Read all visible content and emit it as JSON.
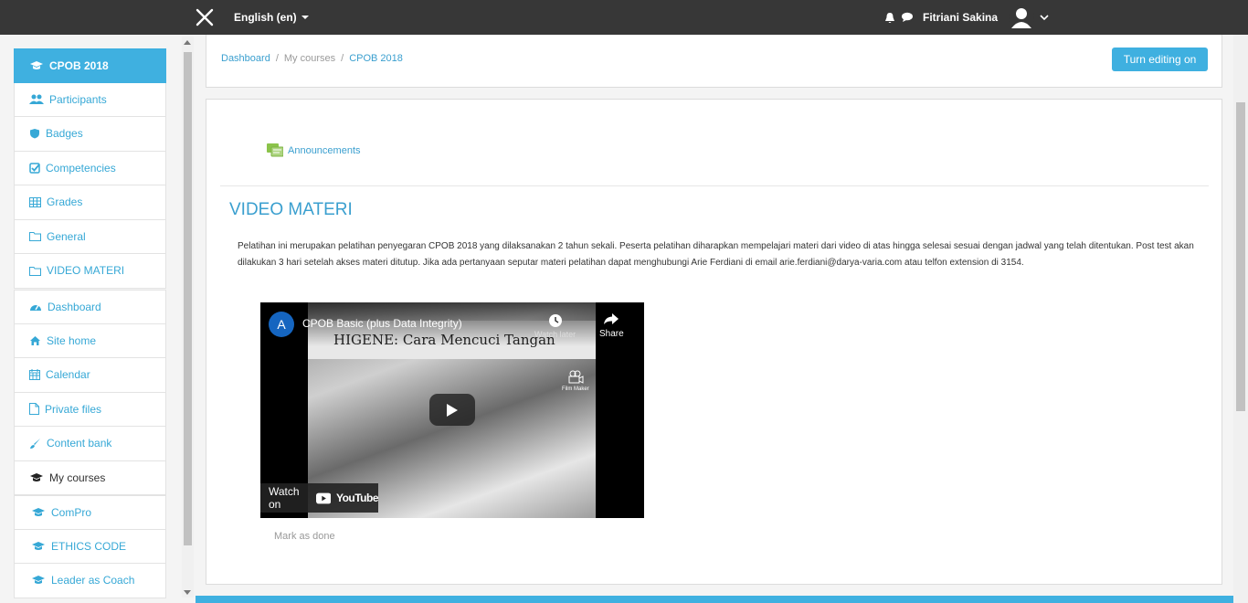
{
  "topbar": {
    "language": "English (en)",
    "user_name": "Fitriani Sakina"
  },
  "sidebar": {
    "items": [
      {
        "label": "CPOB 2018",
        "icon": "graduation-cap-icon",
        "active": true
      },
      {
        "label": "Participants",
        "icon": "users-icon"
      },
      {
        "label": "Badges",
        "icon": "shield-icon"
      },
      {
        "label": "Competencies",
        "icon": "check-square-icon"
      },
      {
        "label": "Grades",
        "icon": "table-icon"
      },
      {
        "label": "General",
        "icon": "folder-icon"
      },
      {
        "label": "VIDEO MATERI",
        "icon": "folder-icon"
      },
      {
        "label": "Dashboard",
        "icon": "dashboard-icon"
      },
      {
        "label": "Site home",
        "icon": "home-icon"
      },
      {
        "label": "Calendar",
        "icon": "calendar-icon"
      },
      {
        "label": "Private files",
        "icon": "file-icon"
      },
      {
        "label": "Content bank",
        "icon": "paint-brush-icon"
      },
      {
        "label": "My courses",
        "icon": "graduation-cap-icon"
      },
      {
        "label": "ComPro",
        "icon": "graduation-cap-icon"
      },
      {
        "label": "ETHICS CODE",
        "icon": "graduation-cap-icon"
      },
      {
        "label": "Leader as Coach",
        "icon": "graduation-cap-icon"
      }
    ]
  },
  "header": {
    "breadcrumbs": [
      "Dashboard",
      "My courses",
      "CPOB 2018"
    ],
    "edit_button": "Turn editing on"
  },
  "course": {
    "announcements": "Announcements",
    "section_title": "VIDEO MATERI",
    "summary": "Pelatihan ini merupakan pelatihan penyegaran CPOB 2018 yang dilaksanakan 2 tahun sekali. Peserta pelatihan diharapkan mempelajari materi dari video di atas hingga selesai sesuai dengan jadwal yang telah ditentukan. Post test akan dilakukan 3 hari setelah akses materi ditutup. Jika ada pertanyaan seputar materi pelatihan dapat menghubungi Arie Ferdiani di email arie.ferdiani@darya-varia.com atau telfon extension di 3154.",
    "mark_done": "Mark as done"
  },
  "video": {
    "channel_initial": "A",
    "title": "CPOB Basic (plus Data Integrity)",
    "watch_later": "Watch later",
    "share": "Share",
    "thumbnail_caption": "HIGENE: Cara Mencuci Tangan",
    "film_maker": "Film Maker",
    "watch_on": "Watch on",
    "youtube": "YouTube"
  },
  "colors": {
    "accent": "#3fb0e0",
    "topbar": "#373737",
    "link": "#3a9fcf"
  }
}
